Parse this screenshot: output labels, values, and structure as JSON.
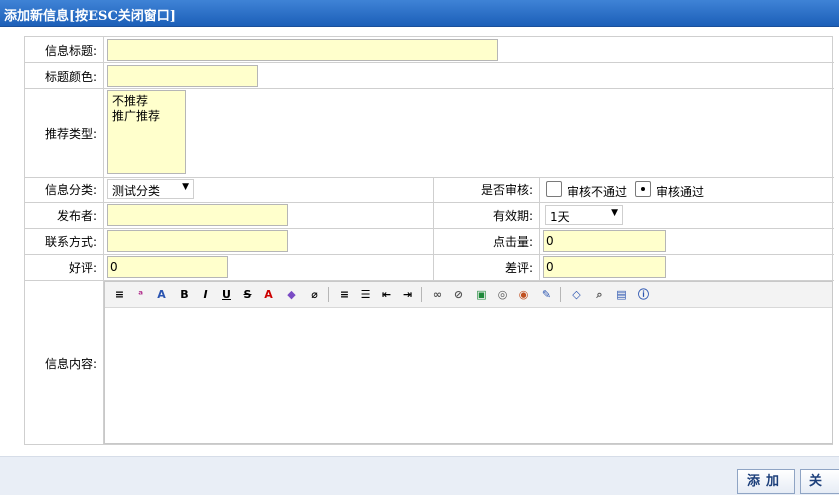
{
  "window": {
    "title": "添加新信息[按ESC关闭窗口]"
  },
  "form": {
    "labels": {
      "info_title": "信息标题:",
      "title_color": "标题颜色:",
      "recommend_type": "推荐类型:",
      "category": "信息分类:",
      "review": "是否审核:",
      "publisher": "发布者:",
      "validity": "有效期:",
      "contact": "联系方式:",
      "hits": "点击量:",
      "good": "好评:",
      "bad": "差评:",
      "content": "信息内容:"
    },
    "recommend_options": [
      "不推荐",
      "推广推荐"
    ],
    "category_selected": "测试分类",
    "review_options": {
      "reject": "审核不通过",
      "pass": "审核通过",
      "selected": "pass"
    },
    "validity_selected": "1天",
    "hits_value": "0",
    "good_value": "0",
    "bad_value": "0"
  },
  "toolbar_icons": [
    "source-format-icon",
    "spell-check-icon",
    "font-size-icon",
    "bold-icon",
    "italic-icon",
    "underline-icon",
    "strikethrough-icon",
    "text-color-icon",
    "highlight-color-icon",
    "eraser-icon",
    "align-icon",
    "list-icon",
    "outdent-icon",
    "indent-icon",
    "link-icon",
    "unlink-icon",
    "image-icon",
    "flash-icon",
    "media-icon",
    "edit-icon",
    "code-icon",
    "preview-icon",
    "fullscreen-icon",
    "about-icon"
  ],
  "buttons": {
    "add": "添加",
    "close": "关闭"
  },
  "colors": {
    "input_bg": "#ffffcc",
    "titlebar": "#2a6cc4",
    "footer_bg": "#e9eef6"
  }
}
